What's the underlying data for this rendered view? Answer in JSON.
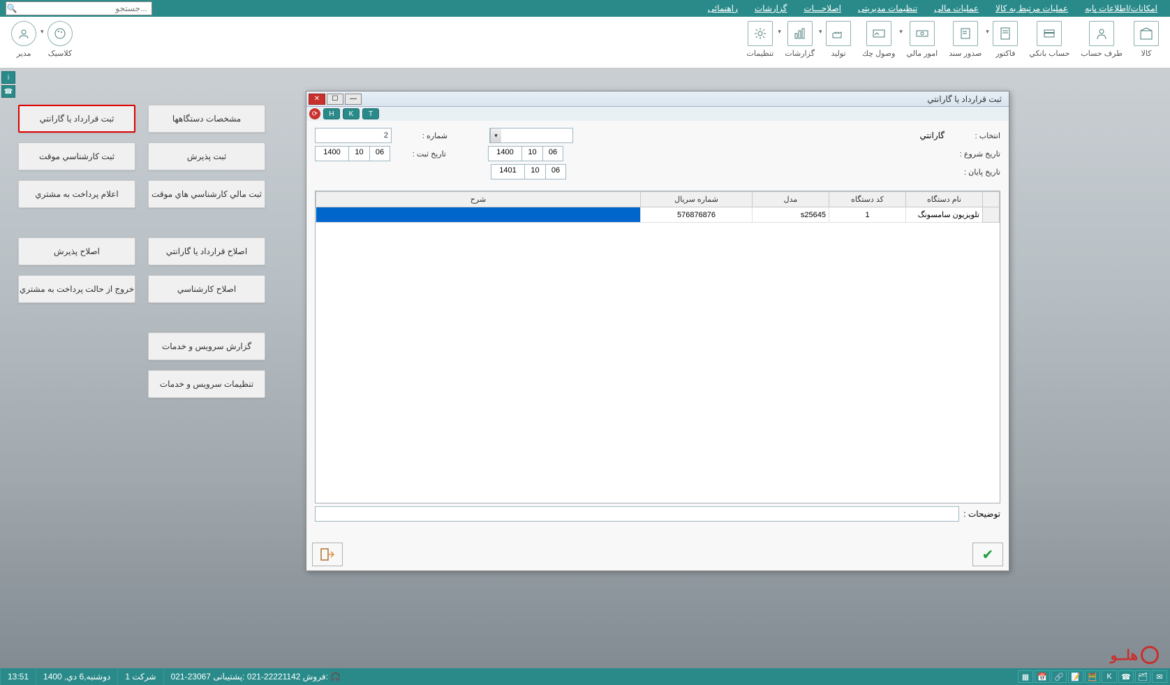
{
  "menu": {
    "items": [
      "امکانات/اطلاعات پایه",
      "عملیات مرتبط به کالا",
      "عملیات مالی",
      "تنظیمات مدیریتی",
      "اصلاحـــات",
      "گزارشات",
      "راهنمائی"
    ],
    "search_placeholder": "جستجو..."
  },
  "ribbon": {
    "items": [
      {
        "label": "کالا"
      },
      {
        "label": "طرف حساب"
      },
      {
        "label": "حساب بانکي"
      },
      {
        "label": "فاکتور"
      },
      {
        "label": "صدور سند"
      },
      {
        "label": "امور مالي"
      },
      {
        "label": "وصول چك"
      },
      {
        "label": "توليد"
      },
      {
        "label": "گزارشات"
      },
      {
        "label": "تنظيمات"
      }
    ],
    "left": [
      {
        "label": "کلاسیک"
      },
      {
        "label": "مدیر"
      }
    ]
  },
  "side": {
    "col1": [
      "مشخصات دستگاهها",
      "ثبت پذيرش",
      "ثبت مالي کارشناسي هاي موقت",
      "اصلاح قرارداد يا گارانتي",
      "اصلاح کارشناسي",
      "گزارش سرويس و خدمات",
      "تنظيمات سرويس و خدمات"
    ],
    "col2": [
      "ثبت قرارداد يا گارانتي",
      "ثبت کارشناسي موقت",
      "اعلام پرداخت به مشتري",
      "اصلاح پذيرش",
      "خروج از حالت پرداخت به مشتري"
    ]
  },
  "dialog": {
    "title": "ثبت قرارداد يا گارانتي",
    "tabs": [
      "T",
      "K",
      "H"
    ],
    "form": {
      "select_label": "انتخاب :",
      "select_value": "گارانتي",
      "number_label": "شماره  :",
      "number_value": "2",
      "start_label": "تاريخ شروع  :",
      "start_date": {
        "y": "1400",
        "m": "10",
        "d": "06"
      },
      "reg_label": "تاريخ ثبت  :",
      "reg_date": {
        "y": "1400",
        "m": "10",
        "d": "06"
      },
      "end_label": "تاريخ پايان  :",
      "end_date": {
        "y": "1401",
        "m": "10",
        "d": "06"
      },
      "desc_label": "توضيحات :"
    },
    "grid": {
      "headers": [
        "نام دستگاه",
        "کد دستگاه",
        "مدل",
        "شماره سريال",
        "شرح"
      ],
      "rows": [
        {
          "name": "تلويزيون سامسونگ",
          "code": "1",
          "model": "s25645",
          "serial": "576876876",
          "desc": ""
        }
      ]
    }
  },
  "logo_text": "هلــو",
  "status": {
    "time": "13:51",
    "date": "دوشنبه,6 دي, 1400",
    "company": "شرکت 1",
    "support": "021-23067",
    "support_lbl": "پشتیبانی:",
    "sales": "021-22221142",
    "sales_lbl": "فروش:"
  }
}
